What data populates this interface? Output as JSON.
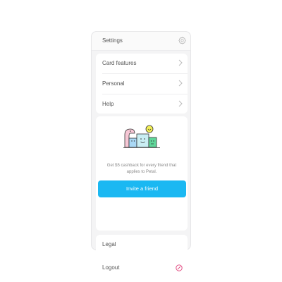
{
  "header": {
    "title": "Settings",
    "settings_icon": "gear-icon"
  },
  "menu": {
    "items": [
      {
        "label": "Card features",
        "icon": "chevron-right-icon"
      },
      {
        "label": "Personal",
        "icon": "chevron-right-icon"
      },
      {
        "label": "Help",
        "icon": "chevron-right-icon"
      }
    ]
  },
  "promo": {
    "illustration": "friends-illustration",
    "text": "Get $5 cashback for every friend that applies to Petal.",
    "button_label": "Invite a friend"
  },
  "legal": {
    "label": "Legal"
  },
  "logout": {
    "label": "Logout",
    "icon": "logout-icon"
  },
  "colors": {
    "accent": "#1bb8f2",
    "logout_icon": "#e0407a",
    "background": "#f4f4f5"
  }
}
